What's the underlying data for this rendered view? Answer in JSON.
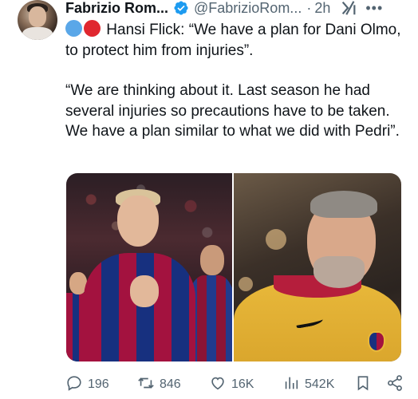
{
  "author": {
    "name": "Fabrizio Rom...",
    "handle": "@FabrizioRom...",
    "separator": "·",
    "time": "2h",
    "verified": true,
    "more_label": "•••"
  },
  "tweet": {
    "line1_prefix_emojis": [
      "blue-circle",
      "red-circle"
    ],
    "paragraph1": "Hansi Flick: “We have a plan for Dani Olmo, to protect him from injuries”.",
    "paragraph2": "“We are thinking about it. Last season he had several injuries so precautions have to be taken. We have a plan similar to what we did with Pedri”."
  },
  "media": {
    "images": [
      {
        "name": "player-photo",
        "description_icon": "player-photo"
      },
      {
        "name": "coach-photo",
        "description_icon": "coach-photo"
      }
    ]
  },
  "actions": {
    "replies": "196",
    "retweets": "846",
    "likes": "16K",
    "views": "542K"
  },
  "colors": {
    "text": "#0f1419",
    "muted": "#536471",
    "verified_blue": "#1d9bf0"
  }
}
